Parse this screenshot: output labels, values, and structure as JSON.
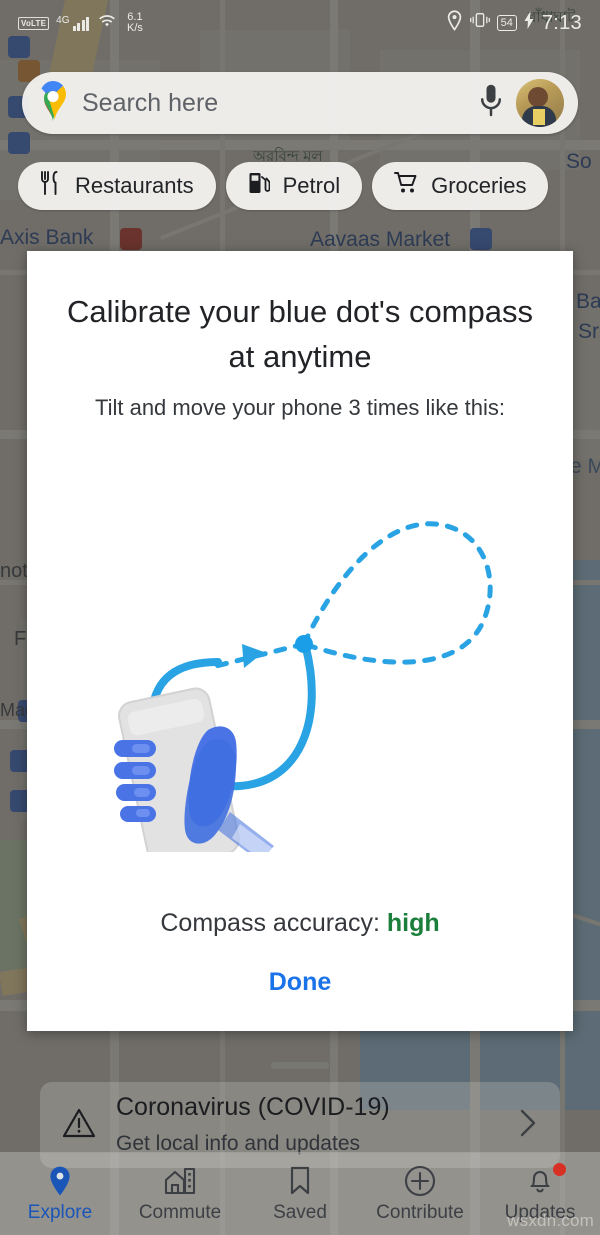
{
  "status_bar": {
    "volte_label": "VoLTE",
    "network_generation": "4G",
    "signal_icon": "signal-bars-icon",
    "wifi_icon": "wifi-icon",
    "data_speed_value": "6.1",
    "data_speed_unit": "K/s",
    "location_icon": "location-pin-icon",
    "vibrate_icon": "vibrate-icon",
    "battery_level": "54",
    "charging_icon": "charging-bolt-icon",
    "time": "7:13"
  },
  "search": {
    "logo_icon": "google-maps-pin-icon",
    "placeholder": "Search here",
    "mic_icon": "microphone-icon",
    "avatar_icon": "user-avatar"
  },
  "chips": [
    {
      "label": "Restaurants",
      "icon": "restaurant-fork-knife-icon"
    },
    {
      "label": "Petrol",
      "icon": "fuel-pump-icon"
    },
    {
      "label": "Groceries",
      "icon": "shopping-cart-icon"
    }
  ],
  "dialog": {
    "title": "Calibrate your blue dot's compass at anytime",
    "subtitle": "Tilt and move your phone 3 times like this:",
    "illustration_icon": "figure-eight-calibration-illustration",
    "accuracy_label": "Compass accuracy:",
    "accuracy_value": "high",
    "accuracy_color": "#1b7f3b",
    "done_label": "Done",
    "done_color": "#1a73e8"
  },
  "bottom_sheet": {
    "handle_icon": "drag-handle",
    "card": {
      "warning_icon": "warning-triangle-icon",
      "title": "Coronavirus (COVID-19)",
      "subtitle": "Get local info and updates",
      "chevron_icon": "chevron-right-icon"
    }
  },
  "bottom_nav": [
    {
      "label": "Explore",
      "icon": "map-pin-icon",
      "active": true
    },
    {
      "label": "Commute",
      "icon": "buildings-icon",
      "active": false
    },
    {
      "label": "Saved",
      "icon": "bookmark-icon",
      "active": false
    },
    {
      "label": "Contribute",
      "icon": "plus-circle-icon",
      "active": false
    },
    {
      "label": "Updates",
      "icon": "bell-icon",
      "active": false,
      "badge": true
    }
  ],
  "map_labels": {
    "l1": "Axis Bank",
    "l2": "অরবিন্দ মল",
    "l3": "Aavaas Market",
    "l4": "বাঁধাঘাট",
    "l5": "So",
    "l6": "Ba",
    "l7": "Sr",
    "l8": "e M",
    "l9": "not",
    "l10": "F",
    "l11": "Mad"
  },
  "watermark": "wsxdn.com",
  "colors": {
    "accent_blue": "#1a73e8",
    "illustration_blue": "#29a3e3",
    "hand_blue": "#3f6fe0",
    "accuracy_green": "#1b7f3b",
    "badge_red": "#d93025"
  }
}
